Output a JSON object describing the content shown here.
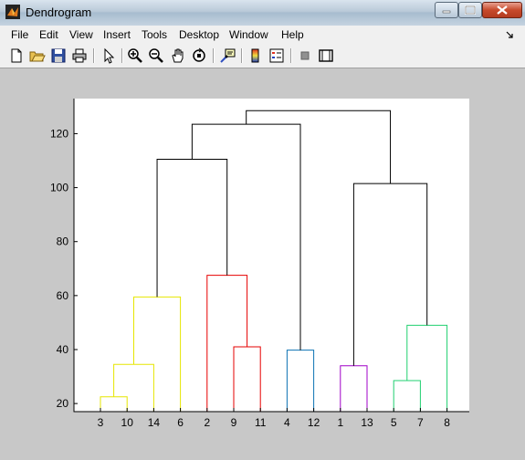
{
  "window": {
    "title": "Dendrogram"
  },
  "menu": [
    "File",
    "Edit",
    "View",
    "Insert",
    "Tools",
    "Desktop",
    "Window",
    "Help"
  ],
  "toolbar": [
    "new-figure",
    "open-file",
    "save",
    "print",
    "edit-plot",
    "zoom-in",
    "zoom-out",
    "pan",
    "rotate-3d",
    "data-cursor",
    "insert-colorbar",
    "insert-legend",
    "hide-plot-tools",
    "show-plot-tools"
  ],
  "chart_data": {
    "type": "dendrogram",
    "leaf_order": [
      "3",
      "10",
      "14",
      "6",
      "2",
      "9",
      "11",
      "4",
      "12",
      "1",
      "13",
      "5",
      "7",
      "8"
    ],
    "y_ticks": [
      20,
      40,
      60,
      80,
      100,
      120
    ],
    "ylim": [
      17,
      133
    ],
    "links": [
      {
        "left": "3",
        "right": "10",
        "height": 22.5,
        "color": "#e6e600"
      },
      {
        "left": "(3,10)",
        "right": "14",
        "height": 34.5,
        "color": "#e6e600"
      },
      {
        "left": "(3,10,14)",
        "right": "6",
        "height": 59.5,
        "color": "#e6e600"
      },
      {
        "left": "9",
        "right": "11",
        "height": 41,
        "color": "#e60000"
      },
      {
        "left": "2",
        "right": "(9,11)",
        "height": 67.5,
        "color": "#e60000"
      },
      {
        "left": "(3,10,14,6)",
        "right": "(2,9,11)",
        "height": 110.5,
        "color": "#000000"
      },
      {
        "left": "4",
        "right": "12",
        "height": 39.8,
        "color": "#0c72b2"
      },
      {
        "left": "(3,10,14,6,2,9,11)",
        "right": "(4,12)",
        "height": 123.5,
        "color": "#000000"
      },
      {
        "left": "1",
        "right": "13",
        "height": 34,
        "color": "#a000c8"
      },
      {
        "left": "5",
        "right": "7",
        "height": 28.5,
        "color": "#20d070"
      },
      {
        "left": "(5,7)",
        "right": "8",
        "height": 49,
        "color": "#20d070"
      },
      {
        "left": "(1,13)",
        "right": "(5,7,8)",
        "height": 101.5,
        "color": "#000000"
      },
      {
        "left": "(3,10,14,6,2,9,11,4,12)",
        "right": "(1,13,5,7,8)",
        "height": 128.5,
        "color": "#000000"
      }
    ]
  }
}
